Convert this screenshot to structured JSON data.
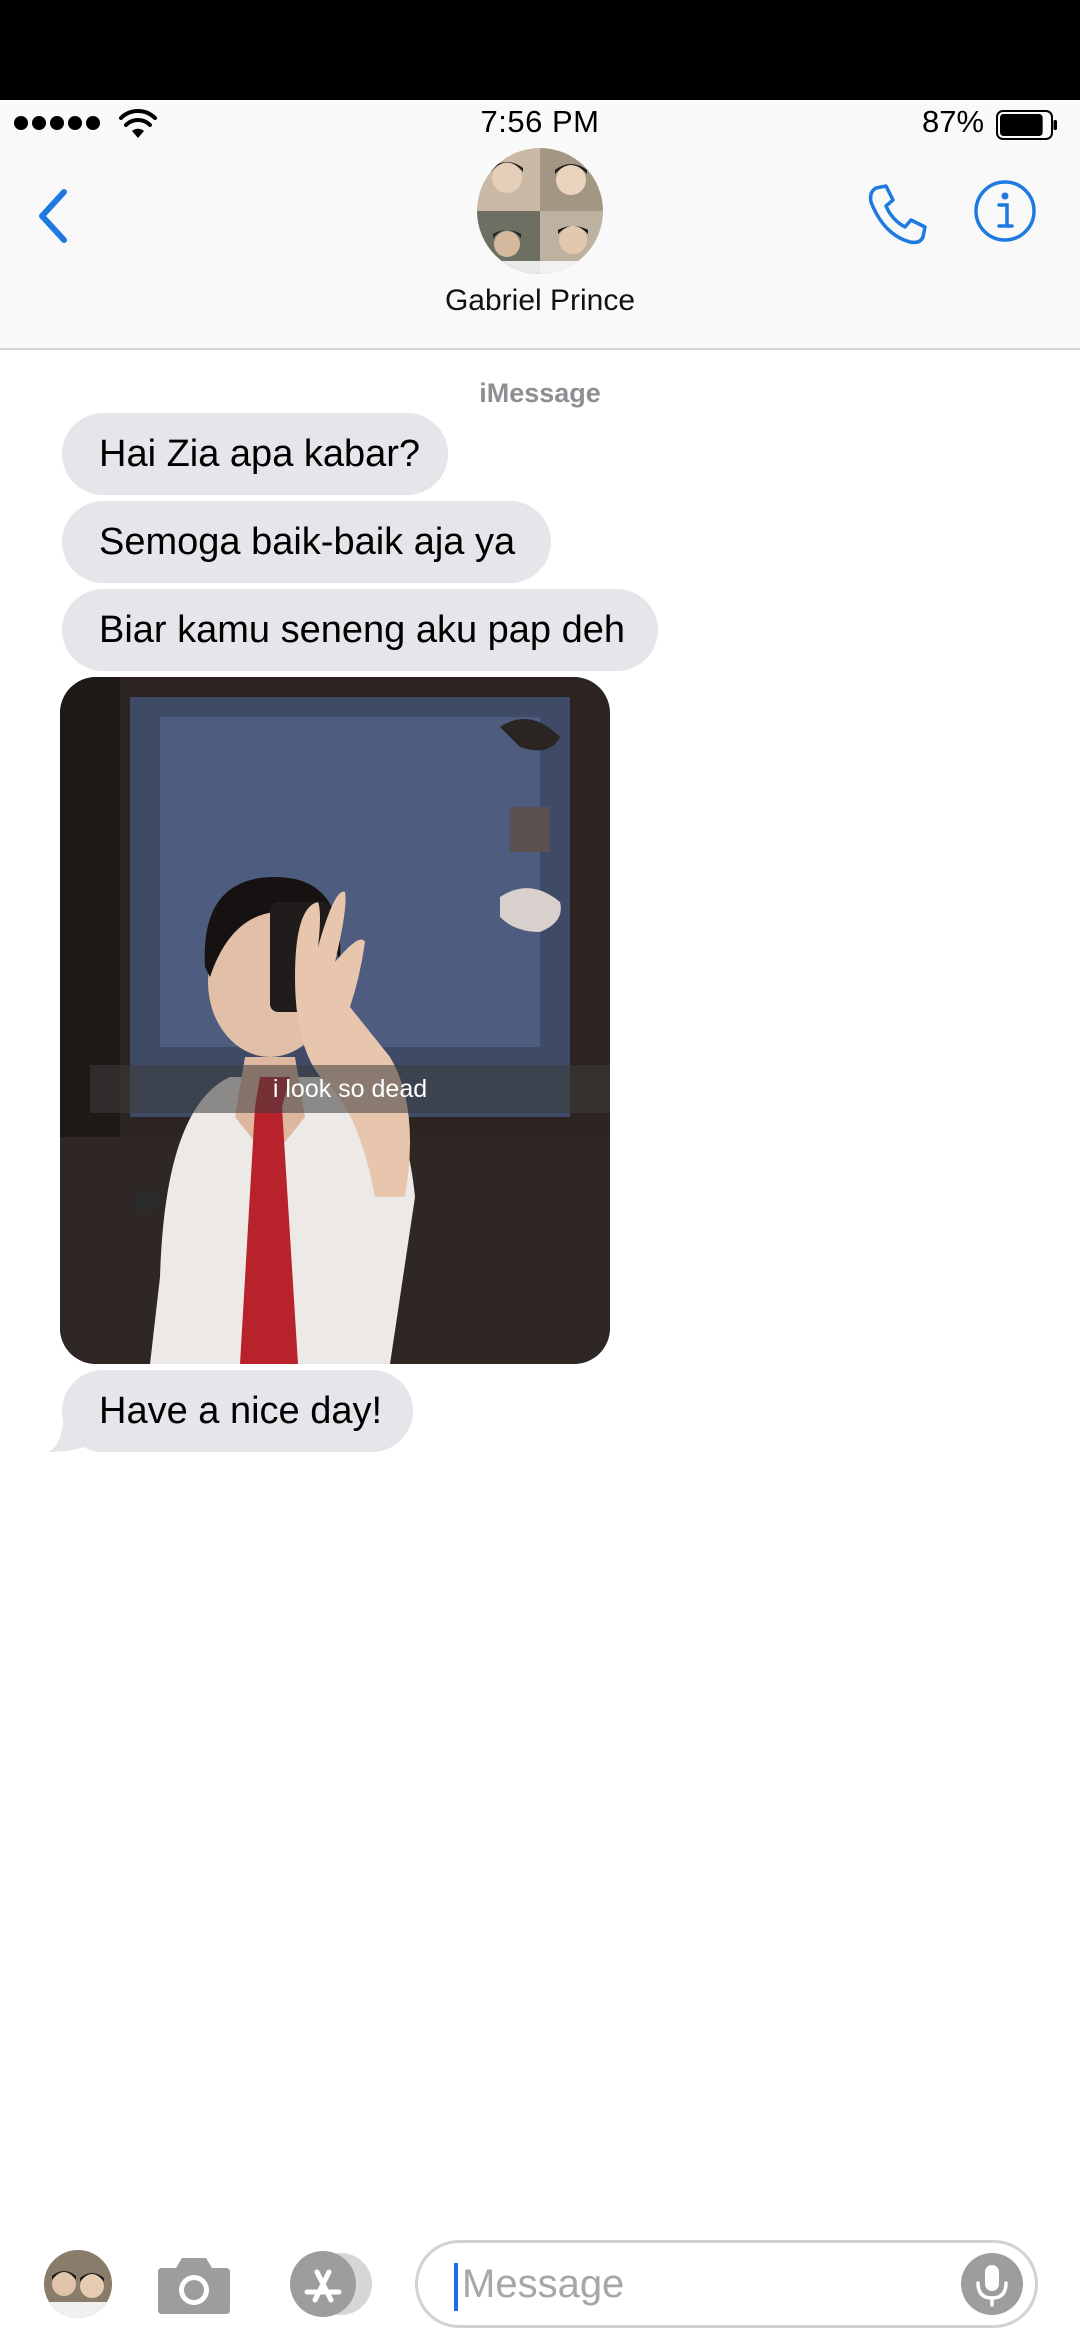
{
  "status_bar": {
    "time": "7:56 PM",
    "battery_percent": "87%",
    "battery_level": 0.87
  },
  "header": {
    "contact_name": "Gabriel Prince"
  },
  "conversation": {
    "service_label": "iMessage",
    "messages": [
      {
        "type": "text",
        "text": "Hai Zia apa kabar?"
      },
      {
        "type": "text",
        "text": "Semoga baik-baik aja ya"
      },
      {
        "type": "text",
        "text": "Biar kamu seneng aku pap deh"
      },
      {
        "type": "photo",
        "caption": "i look so dead"
      },
      {
        "type": "text",
        "text": "Have a nice day!"
      }
    ]
  },
  "composer": {
    "placeholder": "Message"
  },
  "colors": {
    "accent": "#1f7ae0",
    "bubble_gray": "#e5e5ea",
    "header_bg": "#f9f9f9"
  },
  "icons": [
    "back-chevron-icon",
    "phone-icon",
    "info-icon",
    "camera-icon",
    "app-store-icon",
    "microphone-icon",
    "wifi-icon",
    "battery-icon"
  ]
}
